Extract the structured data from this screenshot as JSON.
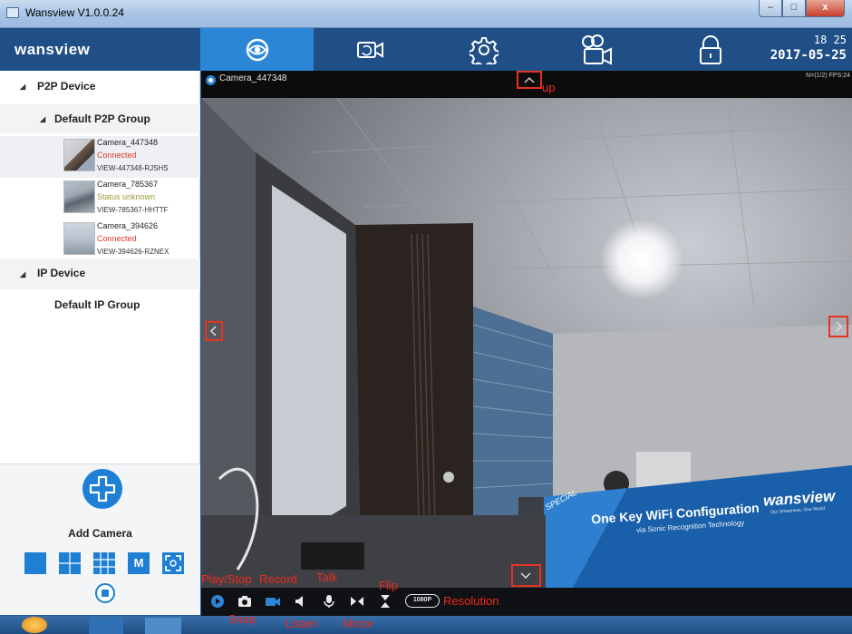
{
  "window": {
    "title": "Wansview  V1.0.0.24",
    "min": "–",
    "max": "□",
    "close": "x"
  },
  "header": {
    "logo": "wansview",
    "tabs": [
      {
        "name": "live-view",
        "icon": "eye-icon",
        "active": true
      },
      {
        "name": "playback",
        "icon": "video-camera-icon",
        "active": false
      },
      {
        "name": "settings",
        "icon": "gear-icon",
        "active": false
      },
      {
        "name": "recording",
        "icon": "cloud-camera-icon",
        "active": false
      },
      {
        "name": "lock",
        "icon": "lock-icon",
        "active": false
      }
    ],
    "time": "18 25",
    "date": "2017-05-25",
    "accent": "#2b86d8",
    "bar_color": "#1f4f86"
  },
  "sidebar": {
    "p2p_device": "P2P Device",
    "p2p_group": "Default P2P Group",
    "cameras": [
      {
        "name": "Camera_447348",
        "status": "Connected",
        "status_color": "#e03a2a",
        "id": "VIEW-447348-RJSHS"
      },
      {
        "name": "Camera_785367",
        "status": "Status unknown",
        "status_color": "#9a9a3a",
        "id": "VIEW-785367-HHTTF"
      },
      {
        "name": "Camera_394626",
        "status": "Connected",
        "status_color": "#e03a2a",
        "id": "VIEW-394626-RZNEX"
      }
    ],
    "ip_device": "IP Device",
    "ip_group": "Default IP Group",
    "add_camera": "Add Camera",
    "layout_m": "M"
  },
  "video": {
    "camera_name": "Camera_447348",
    "stats": "N=(1/2) FPS:24",
    "banner_special": "SPECIAL",
    "banner_title": "One Key WiFi Configuration",
    "banner_sub": "via Sonic Recognition Technology",
    "banner_brand": "wansview",
    "banner_tagline": "Our Smartness, One World"
  },
  "controls": {
    "resolution": "1080P"
  },
  "annotations": {
    "up": "up",
    "play_stop": "Play/Stop",
    "record": "Record",
    "talk": "Talk",
    "flip": "Flip",
    "resolution": "Resolution",
    "snap": "Snap",
    "listen": "Listen",
    "mirror": "Mirror"
  }
}
